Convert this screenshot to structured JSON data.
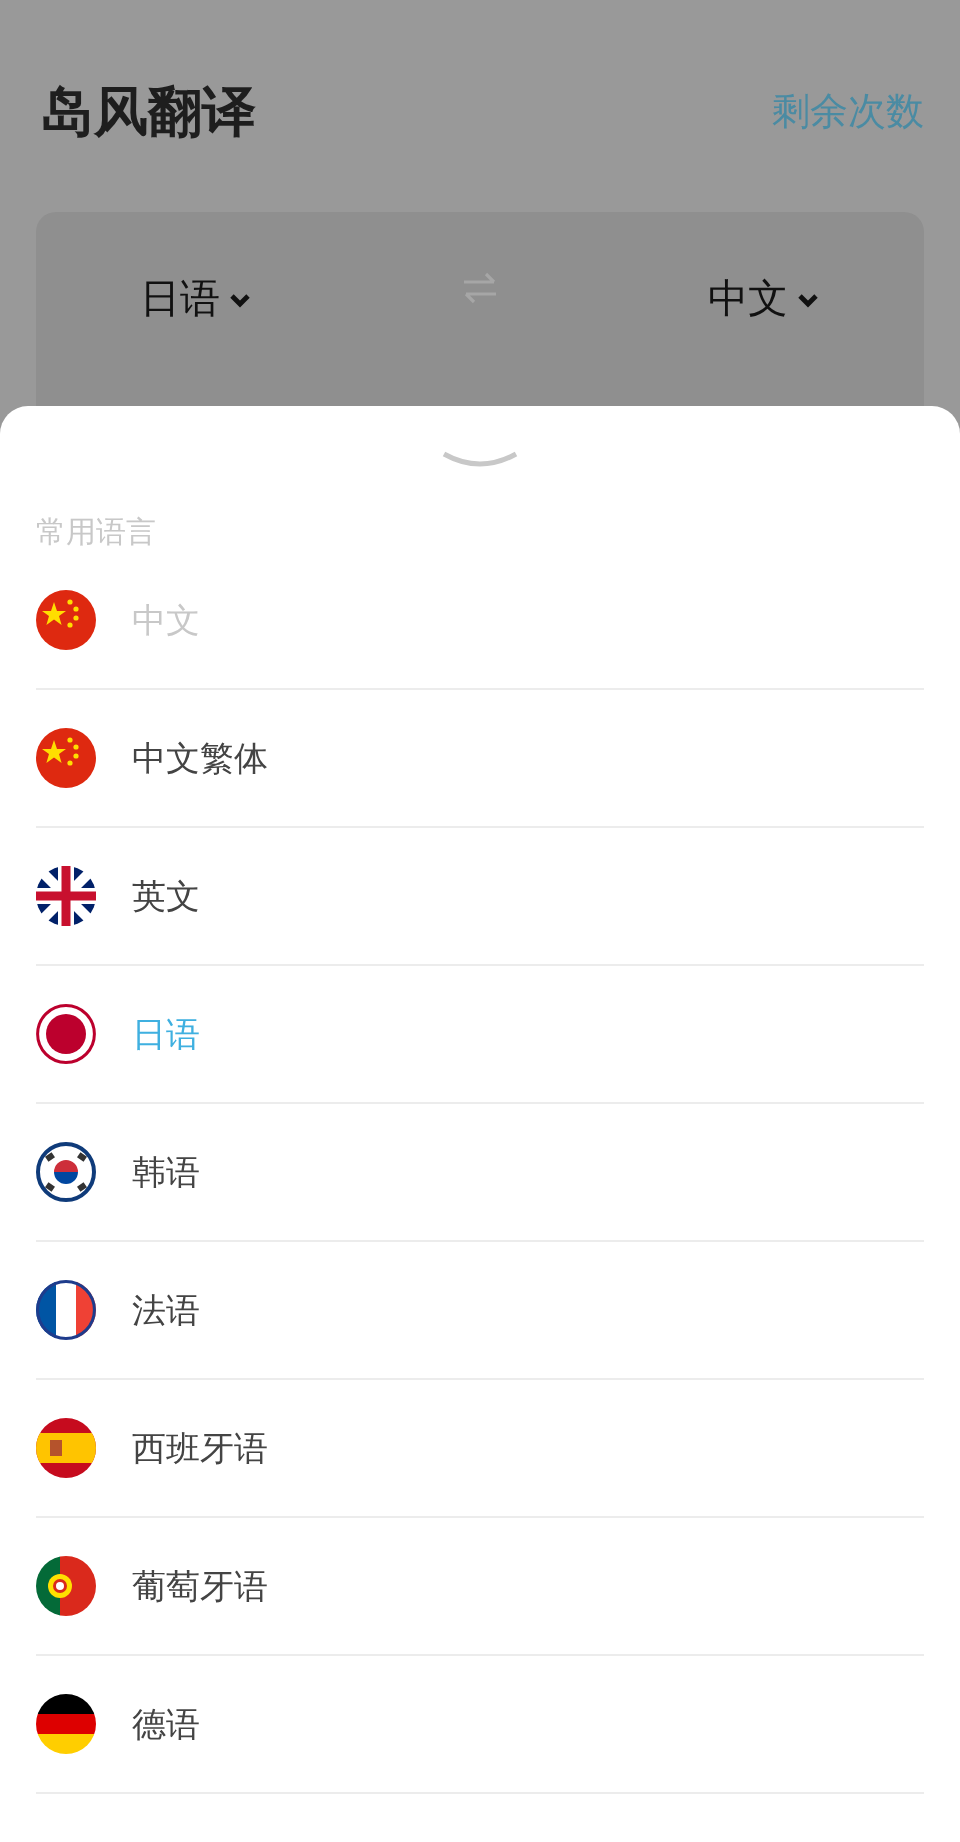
{
  "header": {
    "title": "岛风翻译",
    "link": "剩余次数"
  },
  "language_bar": {
    "source": "日语",
    "target": "中文"
  },
  "sheet": {
    "section_label": "常用语言",
    "languages": [
      {
        "name": "中文",
        "kind": "cn",
        "selected": false,
        "disabled": true
      },
      {
        "name": "中文繁体",
        "kind": "cn",
        "selected": false,
        "disabled": false
      },
      {
        "name": "英文",
        "kind": "gb",
        "selected": false,
        "disabled": false
      },
      {
        "name": "日语",
        "kind": "jp",
        "selected": true,
        "disabled": false
      },
      {
        "name": "韩语",
        "kind": "kr",
        "selected": false,
        "disabled": false
      },
      {
        "name": "法语",
        "kind": "fr",
        "selected": false,
        "disabled": false
      },
      {
        "name": "西班牙语",
        "kind": "es",
        "selected": false,
        "disabled": false
      },
      {
        "name": "葡萄牙语",
        "kind": "pt",
        "selected": false,
        "disabled": false
      },
      {
        "name": "德语",
        "kind": "de",
        "selected": false,
        "disabled": false
      }
    ]
  }
}
